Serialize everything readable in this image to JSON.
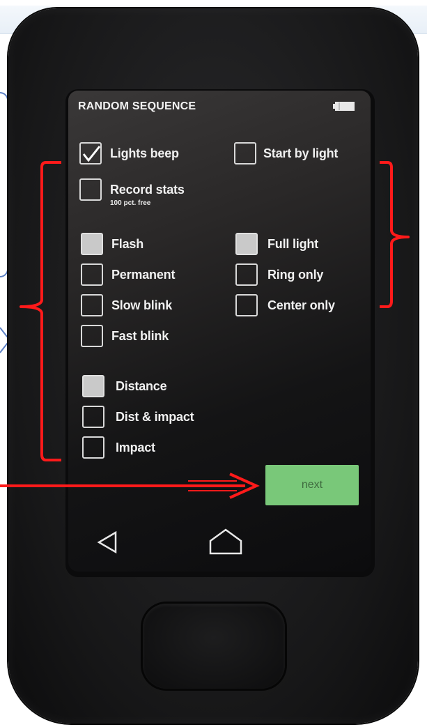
{
  "screen": {
    "title": "RANDOM SEQUENCE",
    "battery_icon": "battery-icon"
  },
  "options": {
    "lights_beep": {
      "label": "Lights beep",
      "checked": true
    },
    "start_by_light": {
      "label": "Start by light",
      "checked": false
    },
    "record_stats": {
      "label": "Record stats",
      "sub": "100 pct. free",
      "checked": false
    },
    "flash": {
      "label": "Flash",
      "selected": true
    },
    "permanent": {
      "label": "Permanent",
      "selected": false
    },
    "slow_blink": {
      "label": "Slow blink",
      "selected": false
    },
    "fast_blink": {
      "label": "Fast blink",
      "selected": false
    },
    "full_light": {
      "label": "Full light",
      "selected": true
    },
    "ring_only": {
      "label": "Ring only",
      "selected": false
    },
    "center_only": {
      "label": "Center only",
      "selected": false
    },
    "distance": {
      "label": "Distance",
      "selected": true
    },
    "dist_impact": {
      "label": "Dist & impact",
      "selected": false
    },
    "impact": {
      "label": "Impact",
      "selected": false
    }
  },
  "next_button": {
    "label": "next",
    "color": "#79c879"
  },
  "nav": {
    "back_icon": "back-triangle-icon",
    "home_icon": "home-icon"
  },
  "annotation_color": "#ff0000"
}
